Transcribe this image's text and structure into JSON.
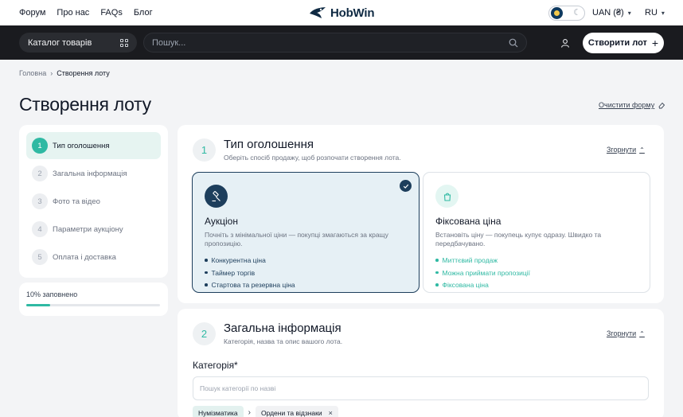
{
  "topnav": {
    "links": [
      "Форум",
      "Про нас",
      "FAQs",
      "Блог"
    ],
    "logo_text": "HobWin",
    "currency": "UAN (₴)",
    "language": "RU"
  },
  "navbar": {
    "catalog_label": "Каталог товарів",
    "search_placeholder": "Пошук...",
    "create_lot_label": "Створити лот"
  },
  "breadcrumb": {
    "home": "Головна",
    "current": "Створення лоту"
  },
  "page": {
    "title": "Створення лоту",
    "clear_form": "Очистити форму"
  },
  "steps": [
    {
      "num": "1",
      "label": "Тип оголошення",
      "active": true
    },
    {
      "num": "2",
      "label": "Загальна інформація",
      "active": false
    },
    {
      "num": "3",
      "label": "Фото та відео",
      "active": false
    },
    {
      "num": "4",
      "label": "Параметри аукціону",
      "active": false
    },
    {
      "num": "5",
      "label": "Оплата і доставка",
      "active": false
    }
  ],
  "progress": {
    "label": "10% заповнено",
    "fraction": 0.18
  },
  "section1": {
    "num": "1",
    "title": "Тип оголошення",
    "subtitle": "Оберіть спосіб продажу, щоб розпочати створення лота.",
    "collapse": "Згорнути",
    "options": [
      {
        "title": "Аукціон",
        "description": "Почніть з мінімальної ціни — покупці змагаються за кращу пропозицію.",
        "features": [
          "Конкурентна ціна",
          "Таймер торгів",
          "Стартова та резервна ціна"
        ]
      },
      {
        "title": "Фіксована ціна",
        "description": "Встановіть ціну — покупець купує одразу. Швидко та передбачувано.",
        "features": [
          "Миттєвий продаж",
          "Можна приймати пропозиції",
          "Фіксована ціна"
        ]
      }
    ]
  },
  "section2": {
    "num": "2",
    "title": "Загальна інформація",
    "subtitle": "Категорія, назва та опис вашого лота.",
    "collapse": "Згорнути",
    "category_label": "Категорія*",
    "category_placeholder": "Пошук категорії по назві",
    "chips": [
      "Нумізматика",
      "Ордени та відзнаки"
    ]
  },
  "colors": {
    "accent_teal": "#2fb9a3",
    "navy": "#1d3e5c",
    "dark_bar": "#1a1b1f"
  }
}
